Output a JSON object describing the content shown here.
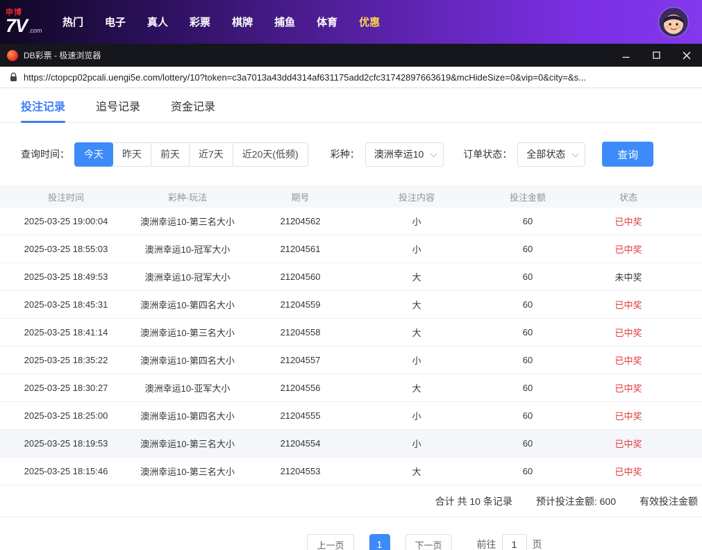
{
  "top_nav": {
    "logo": {
      "brand": "申博",
      "main": "7V",
      "suffix": ".com"
    },
    "items": [
      {
        "label": "热门",
        "state": ""
      },
      {
        "label": "电子",
        "state": ""
      },
      {
        "label": "真人",
        "state": ""
      },
      {
        "label": "彩票",
        "state": ""
      },
      {
        "label": "棋牌",
        "state": ""
      },
      {
        "label": "捕鱼",
        "state": ""
      },
      {
        "label": "体育",
        "state": ""
      },
      {
        "label": "优惠",
        "state": "gold"
      }
    ]
  },
  "browser": {
    "title": "DB彩票 - 极速浏览器",
    "url": "https://ctopcp02pcali.uengi5e.com/lottery/10?token=c3a7013a43dd4314af631175add2cfc31742897663619&mcHideSize=0&vip=0&city=&s..."
  },
  "tabs": [
    {
      "label": "投注记录",
      "state": "active"
    },
    {
      "label": "追号记录",
      "state": ""
    },
    {
      "label": "资金记录",
      "state": ""
    }
  ],
  "filters": {
    "time_label": "查询时间：",
    "time_options": [
      {
        "label": "今天",
        "state": "active"
      },
      {
        "label": "昨天",
        "state": ""
      },
      {
        "label": "前天",
        "state": ""
      },
      {
        "label": "近7天",
        "state": ""
      },
      {
        "label": "近20天(低频)",
        "state": ""
      }
    ],
    "lottery_label": "彩种：",
    "lottery_value": "澳洲幸运10",
    "status_label": "订单状态：",
    "status_value": "全部状态",
    "search_button": "查询"
  },
  "table": {
    "headers": [
      {
        "label": "投注时间"
      },
      {
        "label": "彩种-玩法"
      },
      {
        "label": "期号"
      },
      {
        "label": "投注内容"
      },
      {
        "label": "投注金额"
      },
      {
        "label": "状态"
      }
    ],
    "rows": [
      {
        "time": "2025-03-25 19:00:04",
        "game": "澳洲幸运10-第三名大小",
        "issue": "21204562",
        "content": "小",
        "amount": "60",
        "status": "已中奖",
        "state": "won"
      },
      {
        "time": "2025-03-25 18:55:03",
        "game": "澳洲幸运10-冠军大小",
        "issue": "21204561",
        "content": "小",
        "amount": "60",
        "status": "已中奖",
        "state": "won"
      },
      {
        "time": "2025-03-25 18:49:53",
        "game": "澳洲幸运10-冠军大小",
        "issue": "21204560",
        "content": "大",
        "amount": "60",
        "status": "未中奖",
        "state": "lost"
      },
      {
        "time": "2025-03-25 18:45:31",
        "game": "澳洲幸运10-第四名大小",
        "issue": "21204559",
        "content": "大",
        "amount": "60",
        "status": "已中奖",
        "state": "won"
      },
      {
        "time": "2025-03-25 18:41:14",
        "game": "澳洲幸运10-第三名大小",
        "issue": "21204558",
        "content": "大",
        "amount": "60",
        "status": "已中奖",
        "state": "won"
      },
      {
        "time": "2025-03-25 18:35:22",
        "game": "澳洲幸运10-第四名大小",
        "issue": "21204557",
        "content": "小",
        "amount": "60",
        "status": "已中奖",
        "state": "won"
      },
      {
        "time": "2025-03-25 18:30:27",
        "game": "澳洲幸运10-亚军大小",
        "issue": "21204556",
        "content": "大",
        "amount": "60",
        "status": "已中奖",
        "state": "won"
      },
      {
        "time": "2025-03-25 18:25:00",
        "game": "澳洲幸运10-第四名大小",
        "issue": "21204555",
        "content": "小",
        "amount": "60",
        "status": "已中奖",
        "state": "won"
      },
      {
        "time": "2025-03-25 18:19:53",
        "game": "澳洲幸运10-第三名大小",
        "issue": "21204554",
        "content": "小",
        "amount": "60",
        "status": "已中奖",
        "state": "won"
      },
      {
        "time": "2025-03-25 18:15:46",
        "game": "澳洲幸运10-第三名大小",
        "issue": "21204553",
        "content": "大",
        "amount": "60",
        "status": "已中奖",
        "state": "won"
      }
    ]
  },
  "summary": {
    "record_count": "合计 共 10 条记录",
    "expected_amount": "预计投注金额: 600",
    "valid_amount": "有效投注金额"
  },
  "pagination": {
    "prev": "上一页",
    "current": "1",
    "next": "下一页",
    "goto_label": "前往",
    "goto_value": "1",
    "page_suffix": "页"
  },
  "colors": {
    "accent_blue": "#3d8bf8",
    "win_red": "#e23b3b",
    "nav_gold": "#ffd34d"
  }
}
